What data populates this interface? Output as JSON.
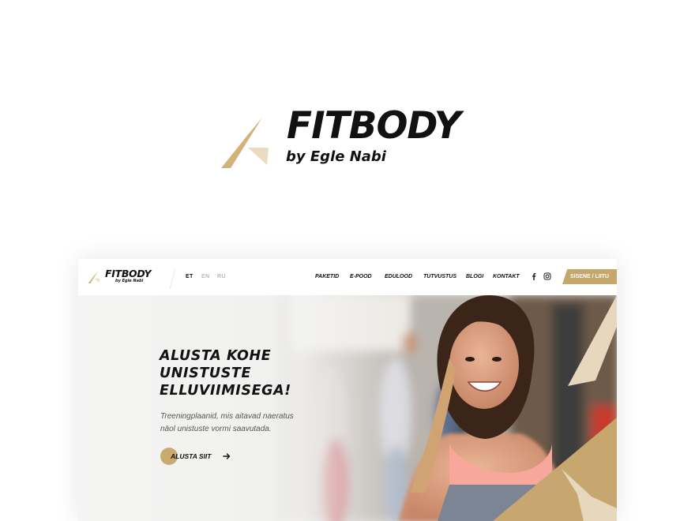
{
  "brand": {
    "name": "FITBODY",
    "byline": "by Egle Nabi",
    "colors": {
      "gold": "#c5a66b",
      "gold_light": "#e9dcc3",
      "dark": "#111111"
    }
  },
  "navbar": {
    "languages": [
      {
        "label": "ET",
        "active": true
      },
      {
        "label": "EN",
        "active": false
      },
      {
        "label": "RU",
        "active": false
      }
    ],
    "menu": [
      "PAKETID",
      "E-POOD",
      "EDULOOD",
      "TUTVUSTUS",
      "BLOGI",
      "KONTAKT"
    ],
    "social_icons": [
      "facebook-icon",
      "instagram-icon"
    ],
    "cta_label": "SISENE / LIITU"
  },
  "hero": {
    "title_lines": [
      "ALUSTA KOHE",
      "UNISTUSTE",
      "ELLUVIIMISEGA!"
    ],
    "subtitle_lines": [
      "Treeningplaanid, mis aitavad naeratus",
      "näol unistuste vormi saavutada."
    ],
    "cta_label": "ALUSTA SIIT",
    "cta_icon": "arrow-right-icon",
    "image": "smiling-woman-in-gym-photo"
  }
}
